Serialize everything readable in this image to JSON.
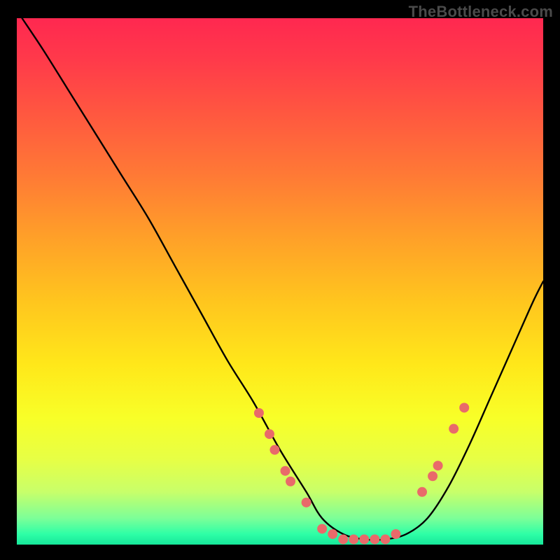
{
  "watermark": "TheBottleneck.com",
  "chart_data": {
    "type": "line",
    "title": "",
    "xlabel": "",
    "ylabel": "",
    "xlim": [
      0,
      100
    ],
    "ylim": [
      0,
      100
    ],
    "grid": false,
    "legend": false,
    "background_gradient": [
      "#ff2850",
      "#ff7a35",
      "#ffe81a",
      "#2effa6"
    ],
    "series": [
      {
        "name": "bottleneck-curve",
        "color": "#000000",
        "x": [
          1,
          5,
          10,
          15,
          20,
          25,
          30,
          35,
          40,
          45,
          50,
          55,
          58,
          62,
          66,
          70,
          74,
          78,
          82,
          86,
          90,
          94,
          98,
          100
        ],
        "y": [
          100,
          94,
          86,
          78,
          70,
          62,
          53,
          44,
          35,
          27,
          18,
          10,
          5,
          2,
          1,
          1,
          2,
          5,
          11,
          19,
          28,
          37,
          46,
          50
        ]
      }
    ],
    "scatter_points": {
      "name": "highlighted-points",
      "color": "#e96a6a",
      "radius": 7,
      "points": [
        {
          "x": 46,
          "y": 25
        },
        {
          "x": 48,
          "y": 21
        },
        {
          "x": 49,
          "y": 18
        },
        {
          "x": 51,
          "y": 14
        },
        {
          "x": 52,
          "y": 12
        },
        {
          "x": 55,
          "y": 8
        },
        {
          "x": 58,
          "y": 3
        },
        {
          "x": 60,
          "y": 2
        },
        {
          "x": 62,
          "y": 1
        },
        {
          "x": 64,
          "y": 1
        },
        {
          "x": 66,
          "y": 1
        },
        {
          "x": 68,
          "y": 1
        },
        {
          "x": 70,
          "y": 1
        },
        {
          "x": 72,
          "y": 2
        },
        {
          "x": 77,
          "y": 10
        },
        {
          "x": 79,
          "y": 13
        },
        {
          "x": 80,
          "y": 15
        },
        {
          "x": 83,
          "y": 22
        },
        {
          "x": 85,
          "y": 26
        }
      ]
    }
  }
}
